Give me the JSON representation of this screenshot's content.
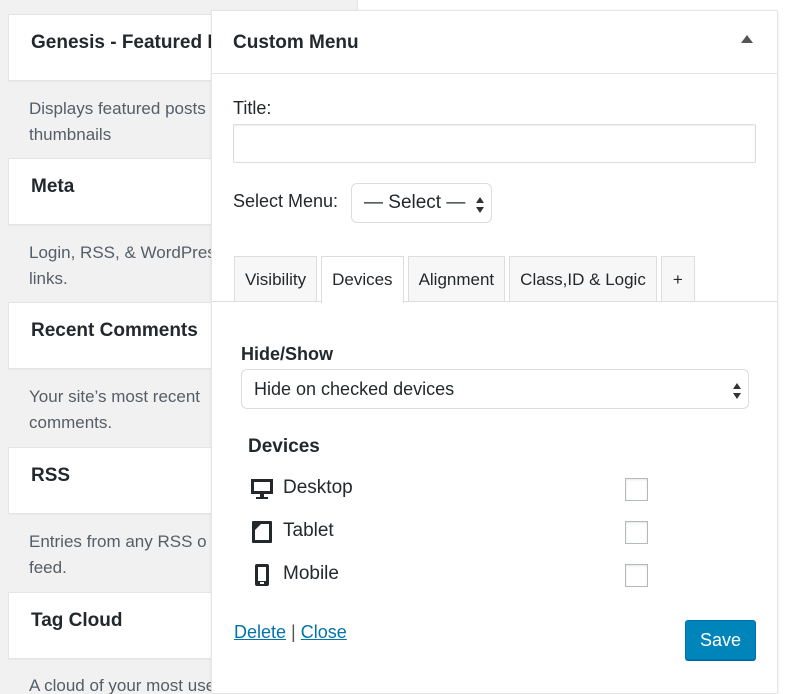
{
  "background_widgets": [
    {
      "title": "Genesis - Featured P",
      "desc": [
        "Displays featured posts",
        "thumbnails"
      ]
    },
    {
      "title": "Meta",
      "desc": [
        "Login, RSS, & WordPress",
        "links."
      ]
    },
    {
      "title": "Recent Comments",
      "desc": [
        "Your site’s most recent",
        "comments."
      ]
    },
    {
      "title": "RSS",
      "desc": [
        "Entries from any RSS o",
        "feed."
      ]
    },
    {
      "title": "Tag Cloud",
      "desc": [
        "A cloud of your most used"
      ]
    }
  ],
  "widget": {
    "title": "Custom Menu",
    "title_label": "Title:",
    "title_value": "",
    "select_menu_label": "Select Menu:",
    "select_menu_value": "— Select —",
    "tabs": [
      "Visibility",
      "Devices",
      "Alignment",
      "Class,ID & Logic",
      "+"
    ],
    "active_tab": "Devices",
    "hide_show_label": "Hide/Show",
    "hide_show_value": "Hide on checked devices",
    "devices_label": "Devices",
    "devices": [
      {
        "label": "Desktop",
        "icon": "desktop-icon",
        "checked": false
      },
      {
        "label": "Tablet",
        "icon": "tablet-icon",
        "checked": false
      },
      {
        "label": "Mobile",
        "icon": "mobile-icon",
        "checked": false
      }
    ],
    "delete_label": "Delete",
    "separator": "|",
    "close_label": "Close",
    "save_label": "Save"
  },
  "colors": {
    "primary": "#0085ba",
    "link": "#0073aa"
  }
}
